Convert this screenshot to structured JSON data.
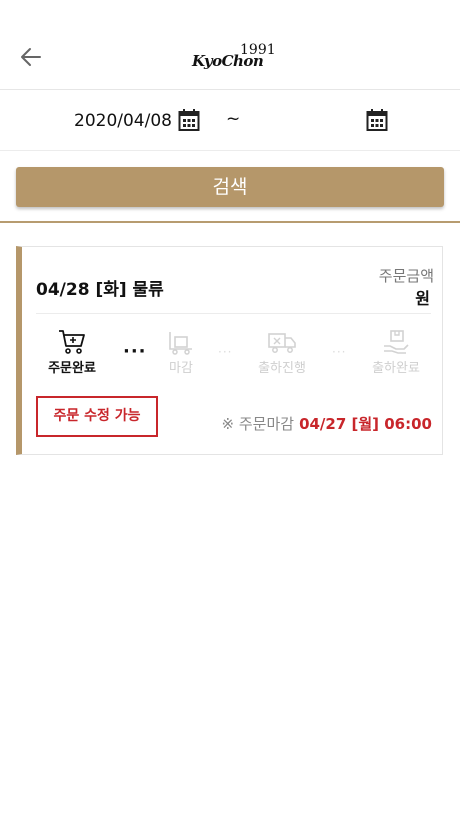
{
  "header": {
    "back_icon": "arrow-left-icon",
    "logo_text": "KyoChon",
    "logo_mark": "1991"
  },
  "date_filter": {
    "start_date": "2020/04/08",
    "separator": "~",
    "end_date": "",
    "calendar_icon": "calendar-icon"
  },
  "search": {
    "label": "검색",
    "color": "#b5976a"
  },
  "orders": [
    {
      "title": "04/28 [화] 물류",
      "amount_label": "주문금액",
      "amount_unit": "원",
      "steps": [
        {
          "label": "주문완료",
          "icon": "cart-icon",
          "active": true
        },
        {
          "label": "마감",
          "icon": "box-cart-icon",
          "active": false
        },
        {
          "label": "출하진행",
          "icon": "truck-icon",
          "active": false
        },
        {
          "label": "출하완료",
          "icon": "hand-box-icon",
          "active": false
        }
      ],
      "modify_button": "주문 수정 가능",
      "deadline_label": "※ 주문마감",
      "deadline_value": "04/27 [월] 06:00",
      "accent_color": "#c8262b"
    }
  ]
}
